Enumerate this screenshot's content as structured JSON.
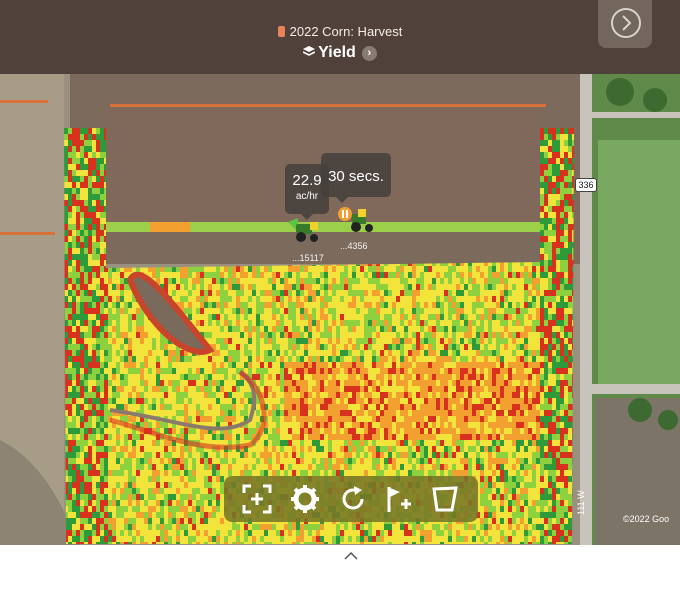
{
  "header": {
    "operation_title": "2022 Corn: Harvest",
    "layer_title": "Yield",
    "swatch_color": "#e8825a",
    "layers_icon": "layers-icon",
    "layer_chevron_icon": "chevron-right-icon",
    "next_icon": "chevron-right-circle-icon"
  },
  "machines": {
    "combine": {
      "rate_value": "22.9",
      "rate_unit": "ac/hr",
      "id_label": "...15117",
      "icon": "combine-icon"
    },
    "tractor": {
      "time_label": "30 secs.",
      "id_label": "...4356",
      "icon": "tractor-icon",
      "status_icon": "pause-icon"
    }
  },
  "map": {
    "road_shield": "336",
    "road_label": "111 W",
    "copyright": "©2022 Goo",
    "yield_colors": {
      "high": "#2e9a3a",
      "above": "#8ed13f",
      "mid": "#f2e43a",
      "below": "#f2a030",
      "low": "#d8321f"
    }
  },
  "toolbar": {
    "tools": [
      {
        "name": "recenter",
        "icon": "recenter-icon"
      },
      {
        "name": "settings",
        "icon": "gear-icon"
      },
      {
        "name": "refresh",
        "icon": "refresh-icon"
      },
      {
        "name": "add-flag",
        "icon": "flag-add-icon"
      },
      {
        "name": "boundary",
        "icon": "boundary-icon"
      }
    ]
  },
  "sheet": {
    "handle_icon": "chevron-up-icon"
  }
}
